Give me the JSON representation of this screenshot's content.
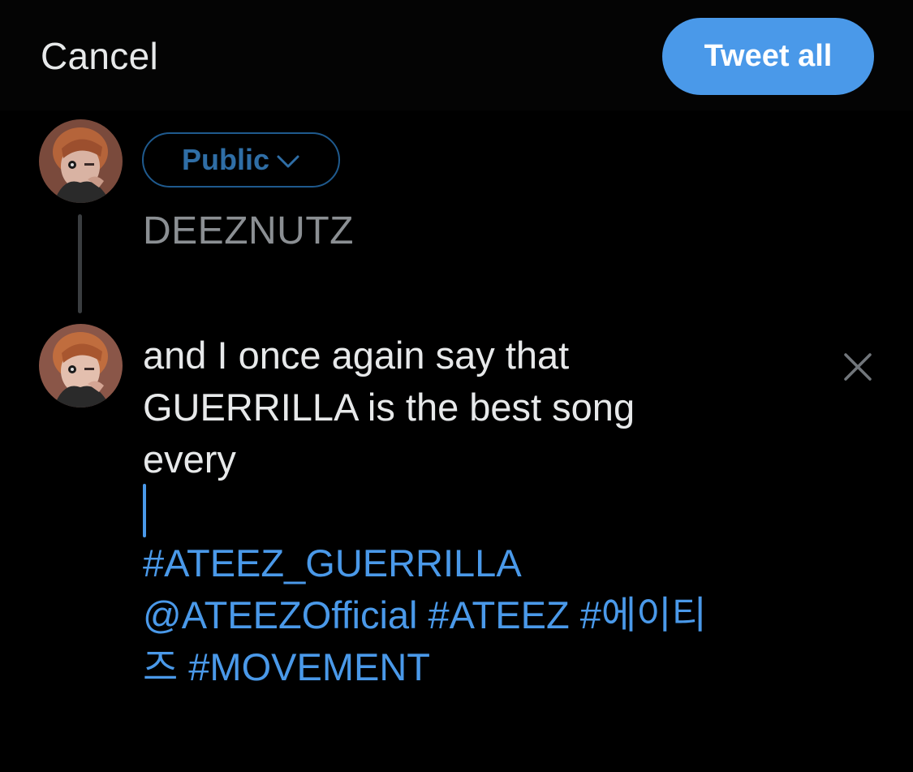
{
  "header": {
    "cancel_label": "Cancel",
    "tweet_all_label": "Tweet all"
  },
  "audience": {
    "label": "Public",
    "icon": "chevron-down-icon"
  },
  "thread": [
    {
      "text": "DEEZNUTZ"
    },
    {
      "lines": [
        "and I once again say that",
        "GUERRILLA is the best song",
        "every"
      ],
      "hashtag_lines": [
        "#ATEEZ_GUERRILLA",
        "@ATEEZOfficial #ATEEZ #에이티",
        "즈 #MOVEMENT"
      ],
      "remove_icon": "close-icon"
    }
  ],
  "colors": {
    "accent": "#4a99e9",
    "audience_border": "#1f5a8e",
    "audience_text": "#2f6ea6",
    "placeholder_text": "#8b8f93",
    "background": "#000000"
  }
}
